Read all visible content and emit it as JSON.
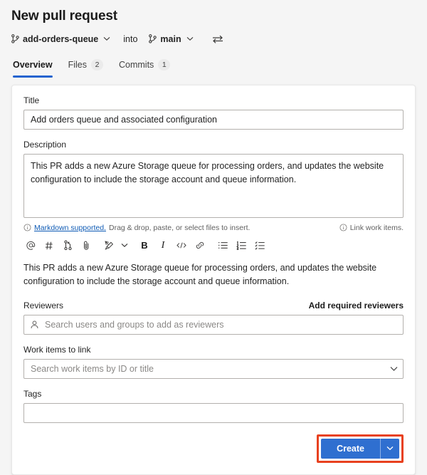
{
  "header": {
    "title": "New pull request",
    "source_branch": "add-orders-queue",
    "into_label": "into",
    "target_branch": "main",
    "source_icon": "branch-icon",
    "target_icon": "branch-icon",
    "swap_icon": "swap-branches-icon",
    "dropdown_icon": "chevron-down-icon"
  },
  "tabs": [
    {
      "label": "Overview",
      "badge": "",
      "active": true
    },
    {
      "label": "Files",
      "badge": "2",
      "active": false
    },
    {
      "label": "Commits",
      "badge": "1",
      "active": false
    }
  ],
  "form": {
    "title": {
      "label": "Title",
      "value": "Add orders queue and associated configuration",
      "placeholder": ""
    },
    "description": {
      "label": "Description",
      "value": "This PR adds a new Azure Storage queue for processing orders, and updates the website configuration to include the storage account and queue information.",
      "placeholder": ""
    },
    "helper": {
      "markdown_link": "Markdown supported.",
      "drag_drop_text": "Drag & drop, paste, or select files to insert.",
      "link_work_items": "Link work items.",
      "info_icon": "info-icon"
    },
    "toolbar": [
      {
        "name": "mention-icon",
        "glyph": "@",
        "title": "Mention"
      },
      {
        "name": "work-item-hash-icon",
        "glyph": "#",
        "title": "Work item"
      },
      {
        "name": "pull-request-icon",
        "glyph": "",
        "title": "Pull request"
      },
      {
        "name": "attach-icon",
        "glyph": "",
        "title": "Attach"
      },
      {
        "name": "highlight-icon",
        "glyph": "",
        "title": "Highlight"
      },
      {
        "name": "chevron-down-icon",
        "glyph": "",
        "title": "More"
      },
      {
        "name": "bold-icon",
        "glyph": "B",
        "title": "Bold"
      },
      {
        "name": "italic-icon",
        "glyph": "I",
        "title": "Italic"
      },
      {
        "name": "code-icon",
        "glyph": "</>",
        "title": "Code"
      },
      {
        "name": "link-icon",
        "glyph": "",
        "title": "Link"
      },
      {
        "name": "bulleted-list-icon",
        "glyph": "",
        "title": "Bulleted list"
      },
      {
        "name": "numbered-list-icon",
        "glyph": "",
        "title": "Numbered list"
      },
      {
        "name": "task-list-icon",
        "glyph": "",
        "title": "Task list"
      }
    ],
    "preview_text": "This PR adds a new Azure Storage queue for processing orders, and updates the website configuration to include the storage account and queue information.",
    "reviewers": {
      "label": "Reviewers",
      "add_required_label": "Add required reviewers",
      "placeholder": "Search users and groups to add as reviewers",
      "value": "",
      "icon": "person-icon"
    },
    "work_items": {
      "label": "Work items to link",
      "placeholder": "Search work items by ID or title",
      "value": "",
      "icon": "chevron-down-icon"
    },
    "tags": {
      "label": "Tags",
      "placeholder": "",
      "value": ""
    }
  },
  "footer": {
    "create_label": "Create",
    "create_menu_icon": "chevron-down-icon",
    "highlight_color": "#e8411f",
    "button_color": "#2f6fd0"
  }
}
